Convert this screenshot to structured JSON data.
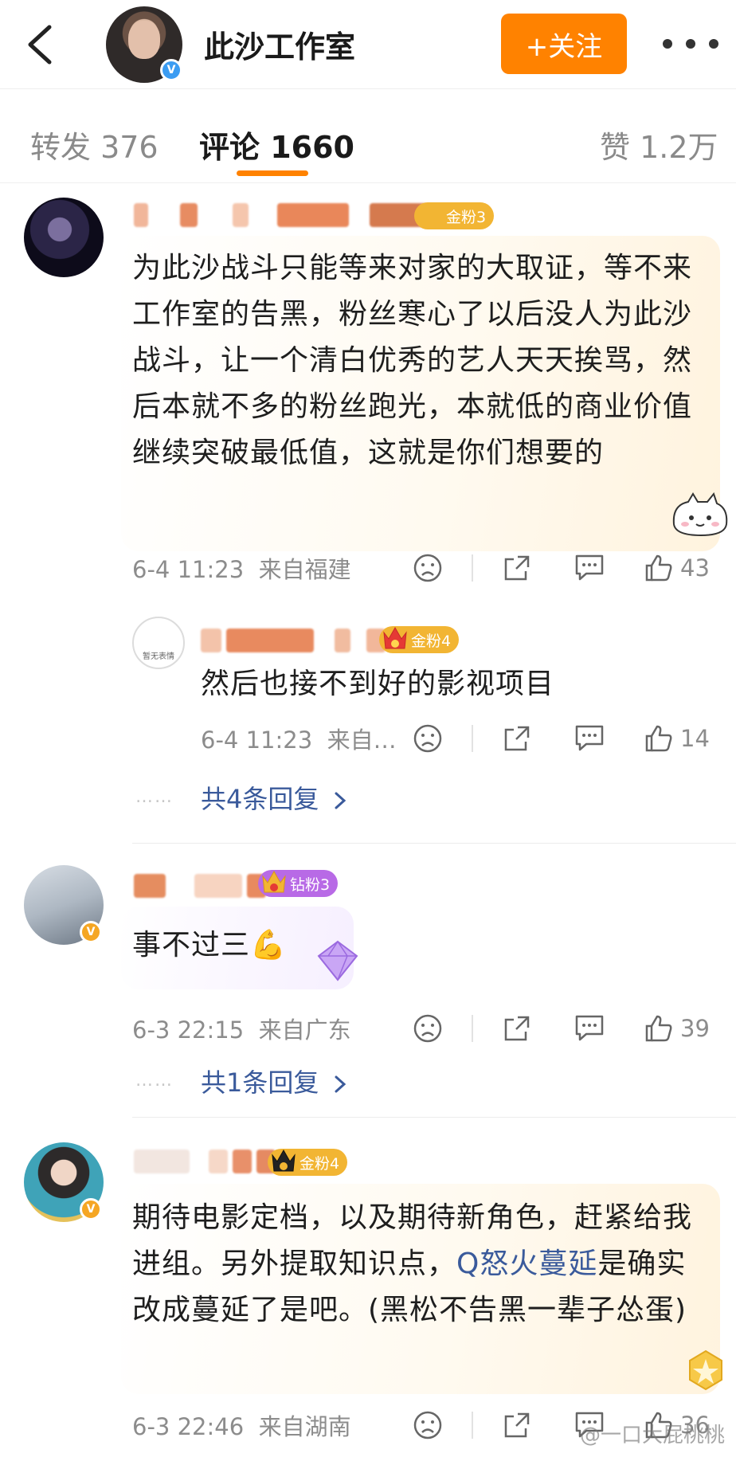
{
  "header": {
    "title": "此沙工作室",
    "follow_label": "+关注"
  },
  "tabs": [
    {
      "label": "转发 376",
      "active": false
    },
    {
      "label": "评论 1660",
      "active": true
    },
    {
      "label": "赞 1.2万",
      "active": false
    }
  ],
  "comments": [
    {
      "fan_badge": "金粉3",
      "text": "为此沙战斗只能等来对家的大取证，等不来工作室的告黑，粉丝寒心了以后没人为此沙战斗，让一个清白优秀的艺人天天挨骂，然后本就不多的粉丝跑光，本就低的商业价值继续突破最低值，这就是你们想要的",
      "time": "6-4 11:23",
      "location": "来自福建",
      "likes": "43",
      "sub_reply": {
        "avatar_text": "暂无表情",
        "name_suffix": "1",
        "fan_badge": "金粉4",
        "text": "然后也接不到好的影视项目",
        "time": "6-4 11:23",
        "location": "来自…",
        "likes": "14"
      },
      "reply_link": "共4条回复"
    },
    {
      "fan_badge": "钻粉3",
      "text": "事不过三💪",
      "time": "6-3 22:15",
      "location": "来自广东",
      "likes": "39",
      "reply_link": "共1条回复"
    },
    {
      "fan_badge": "金粉4",
      "text_part1": "期待电影定档，以及期待新角色，赶紧给我进组。另外提取知识点，",
      "topic": "Q怒火蔓延",
      "text_part2": "是确实改成蔓延了是吧。(黑松不告黑一辈子怂蛋)",
      "time": "6-3 22:46",
      "location": "来自湖南",
      "likes": "36"
    }
  ],
  "dots": "……",
  "watermark": "@一口大屁桃桃",
  "colors": {
    "accent": "#ff8200",
    "link": "#3a5a9b",
    "meta": "#8c8c8c",
    "gold_badge": "#f2b533",
    "diamond_badge": "#b86ae6"
  }
}
